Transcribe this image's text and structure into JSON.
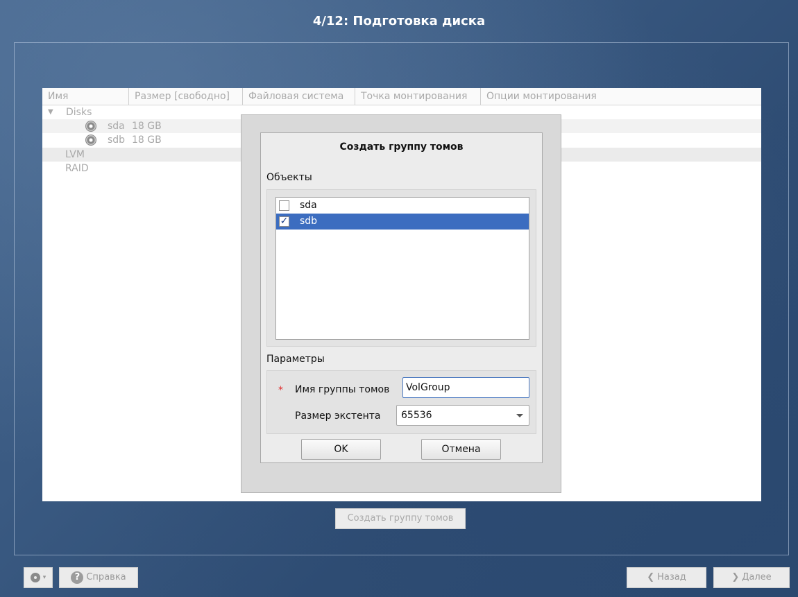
{
  "header": {
    "title": "4/12: Подготовка диска"
  },
  "tree": {
    "columns": [
      "Имя",
      "Размер [свободно]",
      "Файловая система",
      "Точка монтирования",
      "Опции монтирования"
    ],
    "group_disks": "Disks",
    "disks": [
      {
        "name": "sda",
        "size": "18 GB"
      },
      {
        "name": "sdb",
        "size": "18 GB"
      }
    ],
    "group_lvm": "LVM",
    "group_raid": "RAID"
  },
  "create_vg_button": "Создать группу томов",
  "bottom": {
    "help_label": "Справка",
    "back_label": "Назад",
    "next_label": "Далее",
    "back_arrow": "❮",
    "next_arrow": "❯"
  },
  "dialog": {
    "title": "Создать группу томов",
    "objects_label": "Объекты",
    "objects": [
      {
        "label": "sda",
        "checked": false,
        "selected": false
      },
      {
        "label": "sdb",
        "checked": true,
        "selected": true
      }
    ],
    "params_label": "Параметры",
    "required_marker": "*",
    "vg_name_label": "Имя группы томов",
    "vg_name_value": "VolGroup",
    "extent_label": "Размер экстента",
    "extent_value": "65536",
    "ok_label": "OK",
    "cancel_label": "Отмена",
    "checkmark": "✓"
  },
  "colors": {
    "selection": "#3c6dc0",
    "required": "#e03030",
    "background": "#3a5a82"
  }
}
